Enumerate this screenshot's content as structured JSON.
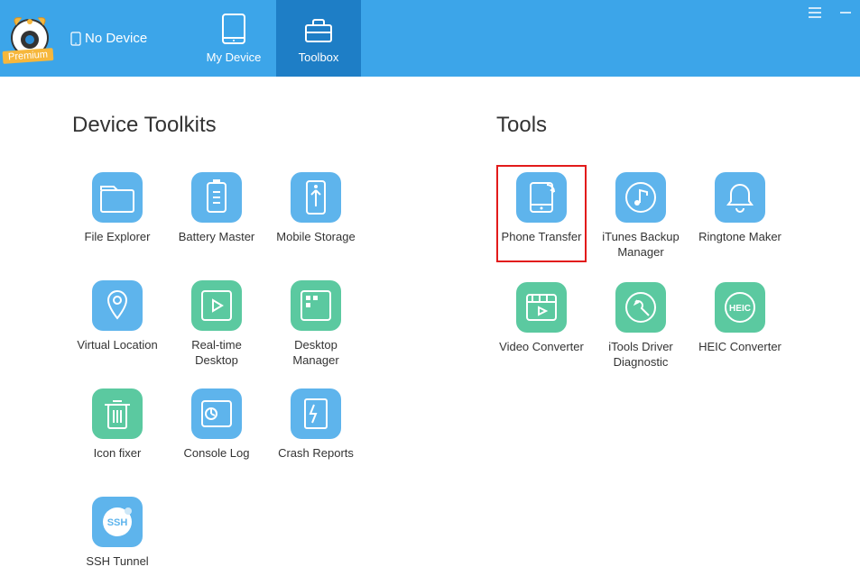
{
  "header": {
    "premium_label": "Premium",
    "device_status": "No Device",
    "tabs": {
      "my_device": "My Device",
      "toolbox": "Toolbox"
    }
  },
  "sections": {
    "device_toolkits_title": "Device Toolkits",
    "tools_title": "Tools"
  },
  "device_toolkits": [
    {
      "label": "File Explorer",
      "color": "blue",
      "icon": "folder"
    },
    {
      "label": "Battery Master",
      "color": "blue",
      "icon": "battery"
    },
    {
      "label": "Mobile Storage",
      "color": "blue",
      "icon": "usb"
    },
    {
      "label": "Virtual Location",
      "color": "blue",
      "icon": "pin"
    },
    {
      "label": "Real-time Desktop",
      "color": "green",
      "icon": "play"
    },
    {
      "label": "Desktop Manager",
      "color": "green",
      "icon": "grid"
    },
    {
      "label": "Icon fixer",
      "color": "green",
      "icon": "trash"
    },
    {
      "label": "Console Log",
      "color": "blue",
      "icon": "console"
    },
    {
      "label": "Crash Reports",
      "color": "blue",
      "icon": "crash"
    },
    {
      "label": "SSH Tunnel",
      "color": "blue",
      "icon": "ssh"
    }
  ],
  "tools": [
    {
      "label": "Phone Transfer",
      "color": "blue",
      "icon": "transfer",
      "highlighted": true
    },
    {
      "label": "iTunes Backup Manager",
      "color": "blue",
      "icon": "music"
    },
    {
      "label": "Ringtone Maker",
      "color": "blue",
      "icon": "bell"
    },
    {
      "label": "Video Converter",
      "color": "green",
      "icon": "video"
    },
    {
      "label": "iTools Driver Diagnostic",
      "color": "green",
      "icon": "wrench"
    },
    {
      "label": "HEIC Converter",
      "color": "green",
      "icon": "heic"
    }
  ],
  "colors": {
    "header_bg": "#3ca5e9",
    "header_active": "#1e7ec6",
    "icon_blue": "#5eb4ec",
    "icon_green": "#5bc9a0",
    "highlight_border": "#e21b1b",
    "premium_badge": "#f6b73c"
  }
}
